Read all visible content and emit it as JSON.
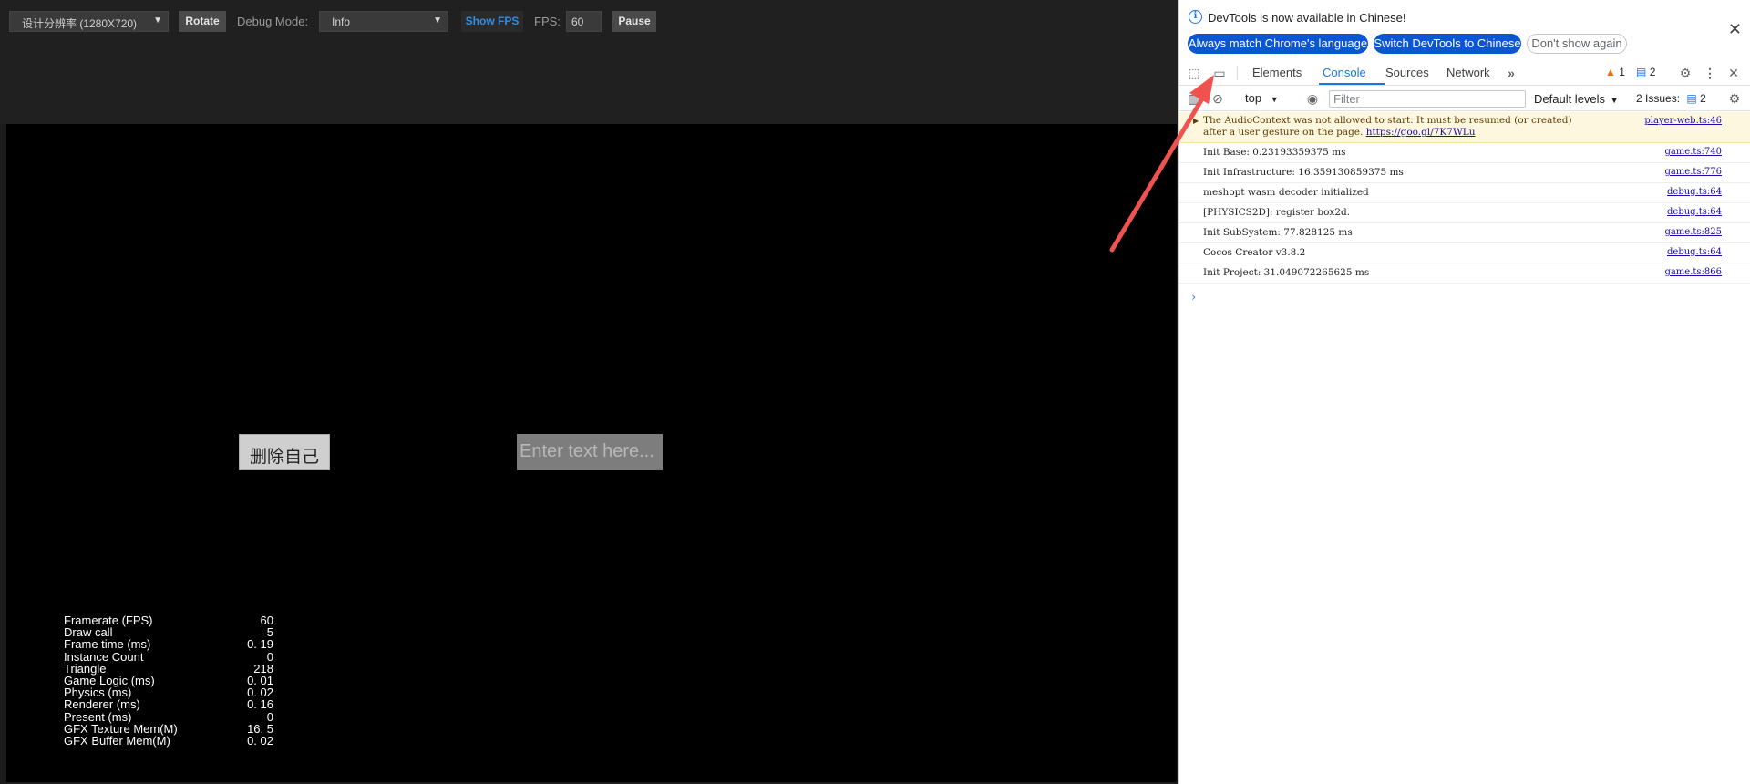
{
  "toolbar": {
    "resolution": "设计分辨率 (1280X720)",
    "rotate": "Rotate",
    "debug_mode_label": "Debug Mode:",
    "debug_mode_value": "Info",
    "show_fps": "Show FPS",
    "fps_label": "FPS:",
    "fps_value": "60",
    "pause": "Pause"
  },
  "scene": {
    "delete_button": "删除自己",
    "text_placeholder": "Enter text here..."
  },
  "stats": [
    {
      "label": "Framerate (FPS)",
      "value": "60"
    },
    {
      "label": "Draw call",
      "value": "5"
    },
    {
      "label": "Frame time (ms)",
      "value": "0. 19"
    },
    {
      "label": "Instance Count",
      "value": "0"
    },
    {
      "label": "Triangle",
      "value": "218"
    },
    {
      "label": "Game Logic (ms)",
      "value": "0. 01"
    },
    {
      "label": "Physics (ms)",
      "value": "0. 02"
    },
    {
      "label": "Renderer (ms)",
      "value": "0. 16"
    },
    {
      "label": "Present (ms)",
      "value": "0"
    },
    {
      "label": "GFX Texture Mem(M)",
      "value": "16. 5"
    },
    {
      "label": "GFX Buffer Mem(M)",
      "value": "0. 02"
    }
  ],
  "devtools": {
    "banner_text": "DevTools is now available in Chinese!",
    "btn_match": "Always match Chrome's language",
    "btn_switch": "Switch DevTools to Chinese",
    "btn_dont_show": "Don't show again",
    "tabs": [
      "Elements",
      "Console",
      "Sources",
      "Network"
    ],
    "warn_count": "1",
    "msg_count": "2",
    "context": "top",
    "filter_placeholder": "Filter",
    "levels": "Default levels",
    "issues": "2 Issues:",
    "issues_count": "2",
    "warning_line1": "The AudioContext was not allowed to start. It must be resumed (or created)",
    "warning_line2": "after a user gesture on the page.",
    "warning_link": "https://goo.gl/7K7WLu",
    "warning_src": "player-web.ts:46",
    "messages": [
      {
        "text": "Init Base: 0.23193359375 ms",
        "src": "game.ts:740"
      },
      {
        "text": "Init Infrastructure: 16.359130859375 ms",
        "src": "game.ts:776"
      },
      {
        "text": "meshopt wasm decoder initialized",
        "src": "debug.ts:64"
      },
      {
        "text": "[PHYSICS2D]: register box2d.",
        "src": "debug.ts:64"
      },
      {
        "text": "Init SubSystem: 77.828125 ms",
        "src": "game.ts:825"
      },
      {
        "text": "Cocos Creator v3.8.2",
        "src": "debug.ts:64"
      },
      {
        "text": "Init Project: 31.049072265625 ms",
        "src": "game.ts:866"
      }
    ],
    "prompt": "›"
  },
  "colors": {
    "accent": "#1a73e8",
    "annotation_arrow": "#f0534f",
    "warning_bg": "#fef7e0"
  }
}
